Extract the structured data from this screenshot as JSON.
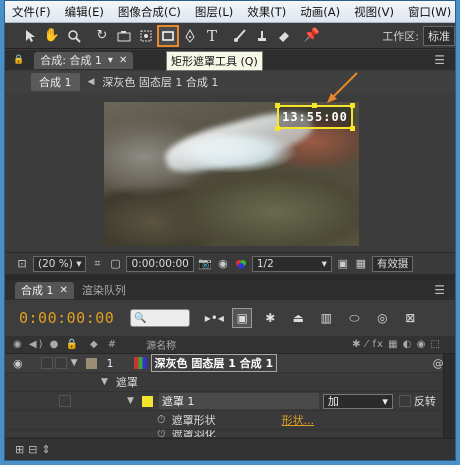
{
  "menu": [
    "文件(F)",
    "编辑(E)",
    "图像合成(C)",
    "图层(L)",
    "效果(T)",
    "动画(A)",
    "视图(V)",
    "窗口(W)"
  ],
  "toolbar": {
    "tooltip": "矩形遮罩工具 (Q)",
    "workspace_label": "工作区:",
    "workspace_value": "标准"
  },
  "comp_panel": {
    "tab_label": "合成: 合成 1",
    "breadcrumb_comp": "合成 1",
    "breadcrumb_layer": "深灰色 固态层 1 合成 1",
    "overlay_timecode": "13:55:00"
  },
  "viewer_controls": {
    "zoom": "(20 %)",
    "timecode": "0:00:00:00",
    "resolution": "1/2",
    "camera": "有效摄"
  },
  "timeline": {
    "tab_label": "合成 1",
    "render_queue_tab": "渲染队列",
    "timecode": "0:00:00:00",
    "search_placeholder": "🔍",
    "col_num": "#",
    "col_source": "源名称",
    "layer_num": "1",
    "layer_name": "深灰色 固态层 1 合成 1",
    "group_masks": "遮罩",
    "mask_name": "遮罩 1",
    "mask_mode": "加",
    "mask_invert": "反转",
    "prop_mask_shape": "遮罩形状",
    "prop_mask_shape_value": "形状...",
    "prop_mask_feather": "遮罩羽化"
  },
  "colors": {
    "accent_orange": "#e8862a",
    "timecode_orange": "#e0a020",
    "mask_yellow": "#f2e52a"
  }
}
